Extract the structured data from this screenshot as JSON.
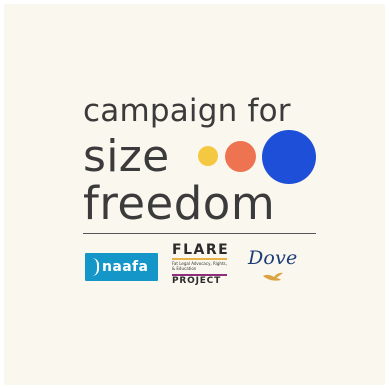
{
  "headline": {
    "line1": "campaign for",
    "line2": "size",
    "line3": "freedom"
  },
  "colors": {
    "background": "#faf7ee",
    "text": "#3b3b3b",
    "dot_yellow": "#f5c842",
    "dot_orange": "#ee7351",
    "dot_blue": "#1e4fd8"
  },
  "partners": {
    "naafa": {
      "name": "naafa",
      "color": "#1596c8"
    },
    "flare": {
      "title": "FLARE",
      "subtitle": "Fat Legal Advocacy, Rights, & Education",
      "project": "PROJECT"
    },
    "dove": {
      "name": "Dove",
      "color": "#1d3c78",
      "icon": "dove-bird-icon"
    }
  }
}
